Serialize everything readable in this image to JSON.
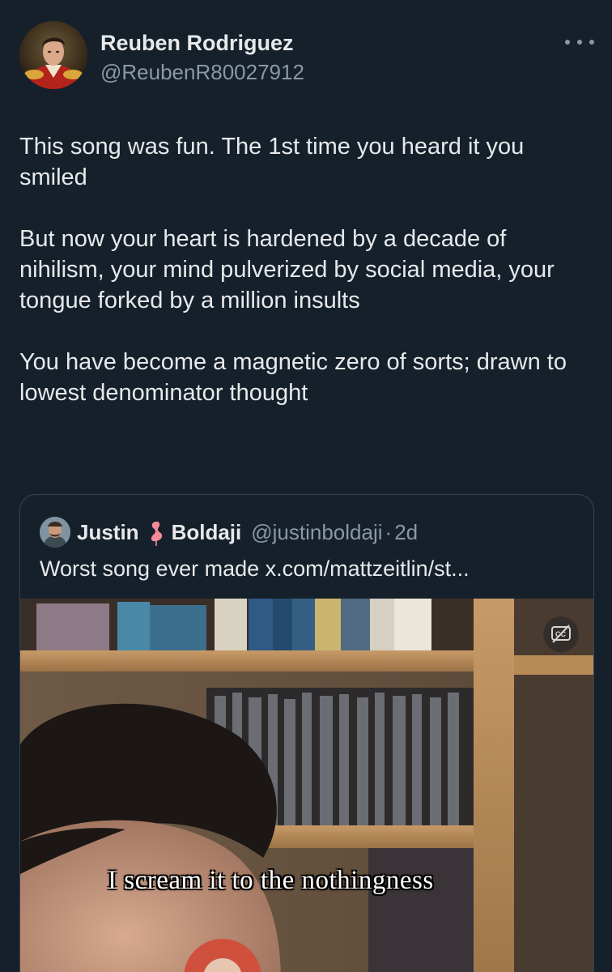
{
  "tweet": {
    "author_name": "Reuben Rodriguez",
    "author_handle": "@ReubenR80027912",
    "paragraphs": [
      "This song was fun. The 1st time you heard it you smiled",
      "But now your heart is hardened by a decade of nihilism, your mind pulverized by social media, your tongue forked by a million insults",
      "You have become a magnetic zero of sorts; drawn to lowest denominator thought"
    ]
  },
  "quote": {
    "author_first": "Justin",
    "author_last": "Boldaji",
    "author_handle": "@justinboldaji",
    "separator": "·",
    "time": "2d",
    "text": "Worst song ever made x.com/mattzeitlin/st...",
    "video_caption": "I scream it to the nothingness"
  },
  "icons": {
    "more": "more-options-icon",
    "flamingo": "flamingo-emoji-icon",
    "captions": "closed-captions-icon"
  },
  "colors": {
    "background": "#15202b",
    "text": "#e7e9ea",
    "secondary": "#8b98a5",
    "border": "#38444d"
  }
}
